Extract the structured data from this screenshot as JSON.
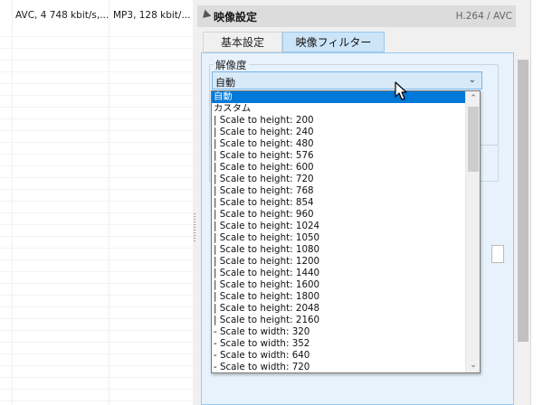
{
  "file_list": {
    "rows": [
      {
        "video": "AVC, 4 748 kbit/s,...",
        "audio": "MP3, 128 kbit/..."
      }
    ]
  },
  "video_section": {
    "title": "映像設定",
    "codec": "H.264 / AVC",
    "tabs": [
      {
        "label": "基本設定",
        "active": false
      },
      {
        "label": "映像フィルター",
        "active": true
      }
    ]
  },
  "resolution": {
    "group_label": "解像度",
    "selected_value": "自動",
    "options": [
      {
        "label": "自動",
        "selected": true
      },
      {
        "label": "カスタム",
        "selected": false
      },
      {
        "label": "| Scale to height: 200",
        "selected": false
      },
      {
        "label": "| Scale to height: 240",
        "selected": false
      },
      {
        "label": "| Scale to height: 480",
        "selected": false
      },
      {
        "label": "| Scale to height: 576",
        "selected": false
      },
      {
        "label": "| Scale to height: 600",
        "selected": false
      },
      {
        "label": "| Scale to height: 720",
        "selected": false
      },
      {
        "label": "| Scale to height: 768",
        "selected": false
      },
      {
        "label": "| Scale to height: 854",
        "selected": false
      },
      {
        "label": "| Scale to height: 960",
        "selected": false
      },
      {
        "label": "| Scale to height: 1024",
        "selected": false
      },
      {
        "label": "| Scale to height: 1050",
        "selected": false
      },
      {
        "label": "| Scale to height: 1080",
        "selected": false
      },
      {
        "label": "| Scale to height: 1200",
        "selected": false
      },
      {
        "label": "| Scale to height: 1440",
        "selected": false
      },
      {
        "label": "| Scale to height: 1600",
        "selected": false
      },
      {
        "label": "| Scale to height: 1800",
        "selected": false
      },
      {
        "label": "| Scale to height: 2048",
        "selected": false
      },
      {
        "label": "| Scale to height: 2160",
        "selected": false
      },
      {
        "label": "- Scale to width: 320",
        "selected": false
      },
      {
        "label": "- Scale to width: 352",
        "selected": false
      },
      {
        "label": "- Scale to width: 640",
        "selected": false
      },
      {
        "label": "- Scale to width: 720",
        "selected": false
      }
    ]
  },
  "icons": {
    "collapse": "collapse-triangle-icon",
    "combo_arrow": "chevron-down-icon",
    "scroll_up": "chevron-up-icon",
    "scroll_down": "chevron-down-icon",
    "cursor": "mouse-cursor-icon"
  },
  "colors": {
    "selection": "#0078d7",
    "active_tab": "#cce4f7",
    "panel": "#e7f2fc"
  }
}
